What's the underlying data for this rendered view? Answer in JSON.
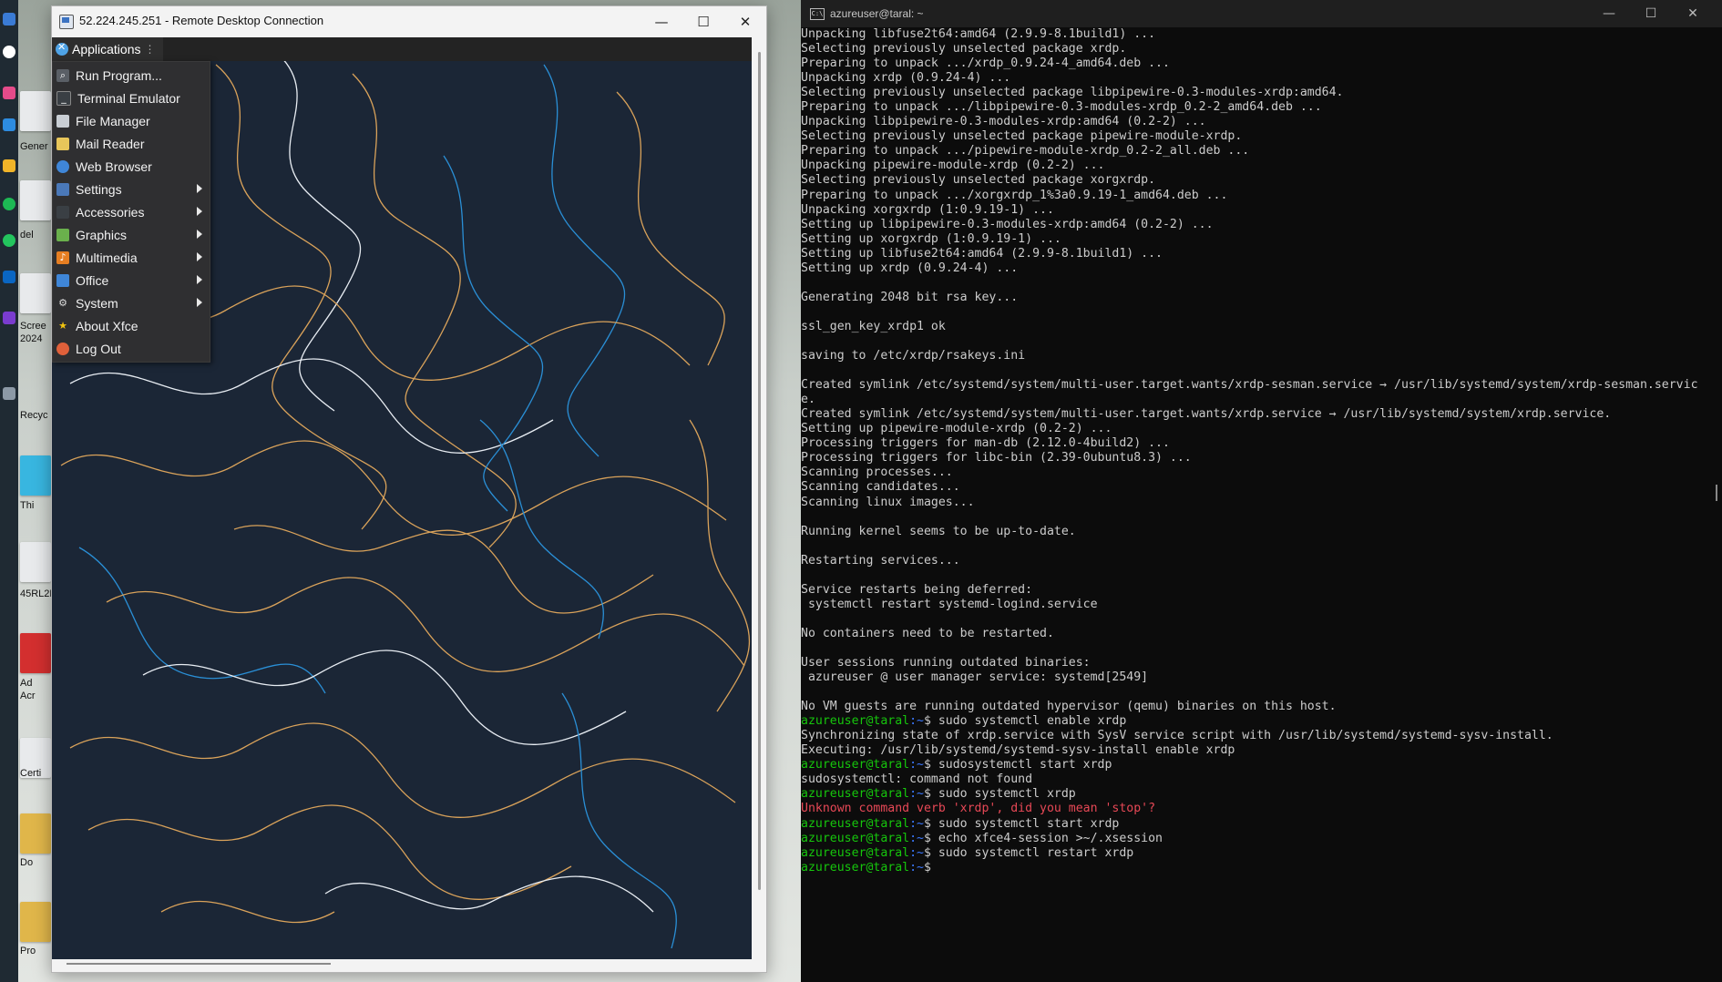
{
  "rdp_window": {
    "title": "52.224.245.251 - Remote Desktop Connection",
    "minimize_glyph": "—",
    "maximize_glyph": "☐",
    "close_glyph": "✕"
  },
  "xfce": {
    "applications_label": "Applications",
    "menu_items": [
      {
        "label": "Run Program...",
        "icon": "search-icon",
        "submenu": false
      },
      {
        "label": "Terminal Emulator",
        "icon": "terminal-icon",
        "submenu": false
      },
      {
        "label": "File Manager",
        "icon": "folder-icon",
        "submenu": false
      },
      {
        "label": "Mail Reader",
        "icon": "mail-icon",
        "submenu": false
      },
      {
        "label": "Web Browser",
        "icon": "globe-icon",
        "submenu": false
      },
      {
        "label": "Settings",
        "icon": "settings-icon",
        "submenu": true
      },
      {
        "label": "Accessories",
        "icon": "accessories-icon",
        "submenu": true
      },
      {
        "label": "Graphics",
        "icon": "graphics-icon",
        "submenu": true
      },
      {
        "label": "Multimedia",
        "icon": "multimedia-icon",
        "submenu": true
      },
      {
        "label": "Office",
        "icon": "office-icon",
        "submenu": true
      },
      {
        "label": "System",
        "icon": "gear-icon",
        "submenu": true
      },
      {
        "label": "About Xfce",
        "icon": "star-icon",
        "submenu": false
      },
      {
        "label": "Log Out",
        "icon": "logout-icon",
        "submenu": false
      }
    ]
  },
  "desktop_icons": [
    {
      "label": "Gener"
    },
    {
      "label": "del"
    },
    {
      "label": "Scree"
    },
    {
      "label": "2024"
    },
    {
      "label": "Recyc"
    },
    {
      "label": "Thi"
    },
    {
      "label": "45RL2F"
    },
    {
      "label": "Ad"
    },
    {
      "label": "Acr"
    },
    {
      "label": "Certi"
    },
    {
      "label": "Do"
    },
    {
      "label": "Pro"
    }
  ],
  "terminal": {
    "title": "azureuser@taral: ~",
    "lines": [
      {
        "t": "Unpacking libfuse2t64:amd64 (2.9.9-8.1build1) ..."
      },
      {
        "t": "Selecting previously unselected package xrdp."
      },
      {
        "t": "Preparing to unpack .../xrdp_0.9.24-4_amd64.deb ..."
      },
      {
        "t": "Unpacking xrdp (0.9.24-4) ..."
      },
      {
        "t": "Selecting previously unselected package libpipewire-0.3-modules-xrdp:amd64."
      },
      {
        "t": "Preparing to unpack .../libpipewire-0.3-modules-xrdp_0.2-2_amd64.deb ..."
      },
      {
        "t": "Unpacking libpipewire-0.3-modules-xrdp:amd64 (0.2-2) ..."
      },
      {
        "t": "Selecting previously unselected package pipewire-module-xrdp."
      },
      {
        "t": "Preparing to unpack .../pipewire-module-xrdp_0.2-2_all.deb ..."
      },
      {
        "t": "Unpacking pipewire-module-xrdp (0.2-2) ..."
      },
      {
        "t": "Selecting previously unselected package xorgxrdp."
      },
      {
        "t": "Preparing to unpack .../xorgxrdp_1%3a0.9.19-1_amd64.deb ..."
      },
      {
        "t": "Unpacking xorgxrdp (1:0.9.19-1) ..."
      },
      {
        "t": "Setting up libpipewire-0.3-modules-xrdp:amd64 (0.2-2) ..."
      },
      {
        "t": "Setting up xorgxrdp (1:0.9.19-1) ..."
      },
      {
        "t": "Setting up libfuse2t64:amd64 (2.9.9-8.1build1) ..."
      },
      {
        "t": "Setting up xrdp (0.9.24-4) ..."
      },
      {
        "t": ""
      },
      {
        "t": "Generating 2048 bit rsa key..."
      },
      {
        "t": ""
      },
      {
        "t": "ssl_gen_key_xrdp1 ok"
      },
      {
        "t": ""
      },
      {
        "t": "saving to /etc/xrdp/rsakeys.ini"
      },
      {
        "t": ""
      },
      {
        "t": "Created symlink /etc/systemd/system/multi-user.target.wants/xrdp-sesman.service → /usr/lib/systemd/system/xrdp-sesman.servic"
      },
      {
        "t": "e."
      },
      {
        "t": "Created symlink /etc/systemd/system/multi-user.target.wants/xrdp.service → /usr/lib/systemd/system/xrdp.service."
      },
      {
        "t": "Setting up pipewire-module-xrdp (0.2-2) ..."
      },
      {
        "t": "Processing triggers for man-db (2.12.0-4build2) ..."
      },
      {
        "t": "Processing triggers for libc-bin (2.39-0ubuntu8.3) ..."
      },
      {
        "t": "Scanning processes..."
      },
      {
        "t": "Scanning candidates..."
      },
      {
        "t": "Scanning linux images..."
      },
      {
        "t": ""
      },
      {
        "t": "Running kernel seems to be up-to-date."
      },
      {
        "t": ""
      },
      {
        "t": "Restarting services..."
      },
      {
        "t": ""
      },
      {
        "t": "Service restarts being deferred:"
      },
      {
        "t": " systemctl restart systemd-logind.service"
      },
      {
        "t": ""
      },
      {
        "t": "No containers need to be restarted."
      },
      {
        "t": ""
      },
      {
        "t": "User sessions running outdated binaries:"
      },
      {
        "t": " azureuser @ user manager service: systemd[2549]"
      },
      {
        "t": ""
      },
      {
        "t": "No VM guests are running outdated hypervisor (qemu) binaries on this host."
      },
      {
        "p": "azureuser@taral",
        "d": ":~",
        "t": "$ sudo systemctl enable xrdp"
      },
      {
        "t": "Synchronizing state of xrdp.service with SysV service script with /usr/lib/systemd/systemd-sysv-install."
      },
      {
        "t": "Executing: /usr/lib/systemd/systemd-sysv-install enable xrdp"
      },
      {
        "p": "azureuser@taral",
        "d": ":~",
        "t": "$ sudosystemctl start xrdp"
      },
      {
        "t": "sudosystemctl: command not found"
      },
      {
        "p": "azureuser@taral",
        "d": ":~",
        "t": "$ sudo systemctl xrdp"
      },
      {
        "t": "Unknown command verb 'xrdp', did you mean 'stop'?",
        "err": true
      },
      {
        "p": "azureuser@taral",
        "d": ":~",
        "t": "$ sudo systemctl start xrdp"
      },
      {
        "p": "azureuser@taral",
        "d": ":~",
        "t": "$ echo xfce4-session >~/.xsession"
      },
      {
        "p": "azureuser@taral",
        "d": ":~",
        "t": "$ sudo systemctl restart xrdp"
      },
      {
        "p": "azureuser@taral",
        "d": ":~",
        "t": "$ "
      }
    ]
  },
  "colors": {
    "terminal_bg": "#0c0c0c",
    "prompt_user": "#16c60c",
    "prompt_path": "#3b78ff",
    "error_text": "#e74856",
    "wallpaper_bg": "#1b2636",
    "contour_orange": "#d9a25a",
    "contour_blue": "#2a8fd6",
    "contour_white": "#e8edf3"
  }
}
